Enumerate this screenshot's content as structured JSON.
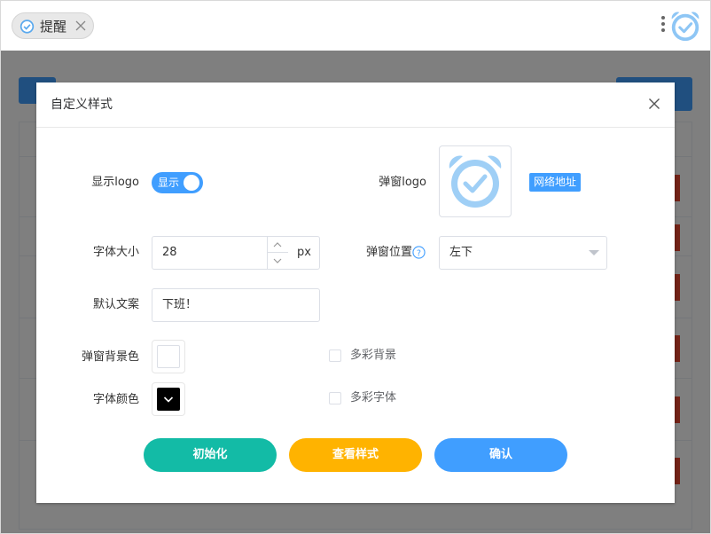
{
  "colors": {
    "accent": "#409eff",
    "danger": "#e6462e",
    "init": "#13bba6",
    "preview": "#ffb300",
    "confirm": "#409eff",
    "text_color_value": "#000000",
    "background_color_value": "#ffffff"
  },
  "browser": {
    "tab": {
      "label": "提醒",
      "icon": "alarm-clock-icon"
    },
    "menu_icon": "more-vertical-icon",
    "app_icon": "alarm-clock-icon"
  },
  "dialog": {
    "title": "自定义样式",
    "show_logo": {
      "label": "显示logo",
      "switch_text": "显示",
      "on": true
    },
    "popup_logo": {
      "label": "弹窗logo",
      "image": "alarm-clock-icon",
      "link_label": "网络地址"
    },
    "font_size": {
      "label": "字体大小",
      "value": "28",
      "unit": "px"
    },
    "popup_position": {
      "label": "弹窗位置",
      "help_icon": "question-icon",
      "value": "左下"
    },
    "default_text": {
      "label": "默认文案",
      "value": "下班！"
    },
    "popup_bg_color": {
      "label": "弹窗背景色"
    },
    "font_color": {
      "label": "字体颜色"
    },
    "colorful_bg": {
      "label": "多彩背景",
      "checked": false
    },
    "colorful_font": {
      "label": "多彩字体",
      "checked": false
    },
    "buttons": {
      "init": "初始化",
      "preview": "查看样式",
      "confirm": "确认"
    }
  }
}
